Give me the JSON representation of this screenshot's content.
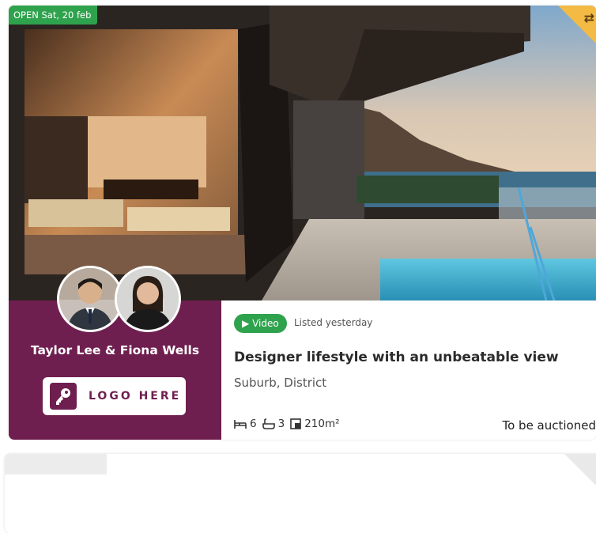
{
  "listing": {
    "open_badge": "OPEN Sat, 20 feb",
    "agents_name": "Taylor Lee & Fiona Wells",
    "logo_text": "LOGO HERE",
    "video_label": "Video",
    "listed_text": "Listed yesterday",
    "title": "Designer lifestyle with an unbeatable view",
    "location": "Suburb, District",
    "features": {
      "beds": "6",
      "baths": "3",
      "area": "210m²"
    },
    "price": "To be auctioned"
  },
  "colors": {
    "brand": "#6f1f4f",
    "badge_green": "#2fa24d",
    "corner_gold": "#f3bb44"
  }
}
